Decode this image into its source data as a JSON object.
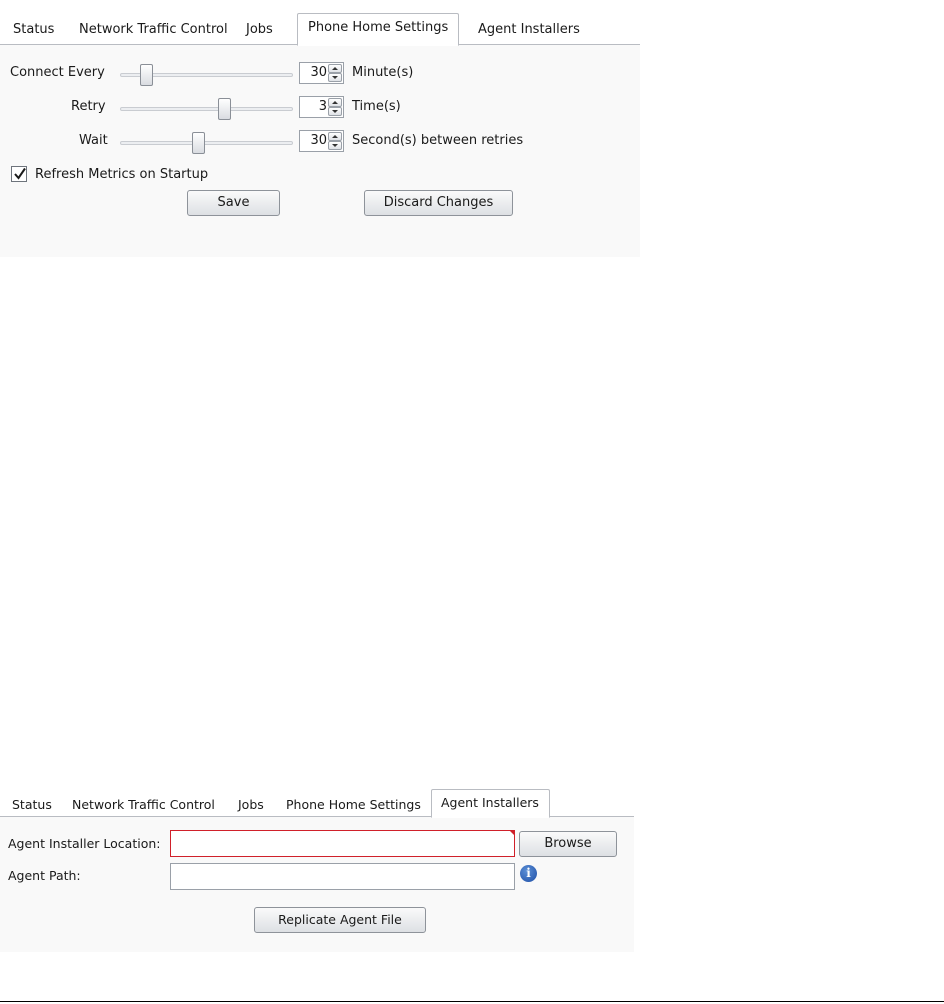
{
  "panel1": {
    "tabs": [
      {
        "label": "Status"
      },
      {
        "label": "Network Traffic Control"
      },
      {
        "label": "Jobs"
      },
      {
        "label": "Phone Home Settings"
      },
      {
        "label": "Agent Installers"
      }
    ],
    "active_tab": "Phone Home Settings",
    "rows": [
      {
        "label": "Connect Every",
        "value": "30",
        "unit": "Minute(s)",
        "slider_level": 0.15
      },
      {
        "label": "Retry",
        "value": "3",
        "unit": "Time(s)",
        "slider_level": 0.6
      },
      {
        "label": "Wait",
        "value": "30",
        "unit": "Second(s) between retries",
        "slider_level": 0.45
      }
    ],
    "refresh_checkbox": {
      "label": "Refresh Metrics on Startup",
      "checked": true
    },
    "save_label": "Save",
    "discard_label": "Discard Changes"
  },
  "panel2": {
    "tabs": [
      {
        "label": "Status"
      },
      {
        "label": "Network Traffic Control"
      },
      {
        "label": "Jobs"
      },
      {
        "label": "Phone Home Settings"
      },
      {
        "label": "Agent Installers"
      }
    ],
    "active_tab": "Agent Installers",
    "installer_location_label": "Agent Installer Location:",
    "installer_location_value": "",
    "browse_label": "Browse",
    "agent_path_label": "Agent Path:",
    "agent_path_value": "",
    "info_icon": "i",
    "replicate_label": "Replicate Agent File"
  },
  "colors": {
    "error_border": "#d0202a",
    "info_icon": "#2a5db0"
  }
}
